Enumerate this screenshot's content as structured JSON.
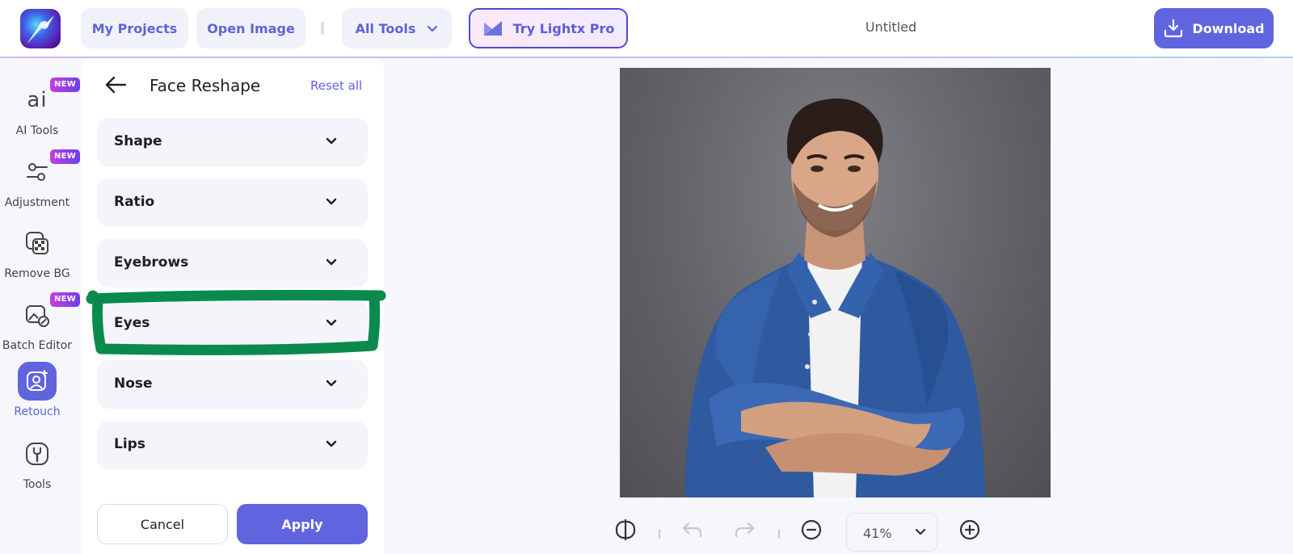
{
  "header": {
    "my_projects": "My Projects",
    "open_image": "Open Image",
    "all_tools": "All Tools",
    "try_pro": "Try Lightx Pro",
    "doc_title": "Untitled",
    "download": "Download"
  },
  "rail": {
    "items": [
      {
        "label": "AI Tools",
        "icon": "ai-icon",
        "badge": "NEW"
      },
      {
        "label": "Adjustment",
        "icon": "adjustment-sliders-icon",
        "badge": "NEW"
      },
      {
        "label": "Remove BG",
        "icon": "remove-bg-icon"
      },
      {
        "label": "Batch Editor",
        "icon": "batch-editor-icon",
        "badge": "NEW"
      },
      {
        "label": "Retouch",
        "icon": "retouch-icon",
        "active": true
      },
      {
        "label": "Tools",
        "icon": "tools-icon"
      }
    ],
    "ai_glyph": "ai"
  },
  "panel": {
    "title": "Face Reshape",
    "reset": "Reset all",
    "sections": [
      "Shape",
      "Ratio",
      "Eyebrows",
      "Eyes",
      "Nose",
      "Lips"
    ],
    "cancel": "Cancel",
    "apply": "Apply"
  },
  "toolbar": {
    "zoom": "41%"
  },
  "colors": {
    "accent": "#6064df",
    "annotation": "#0b8a4e"
  }
}
